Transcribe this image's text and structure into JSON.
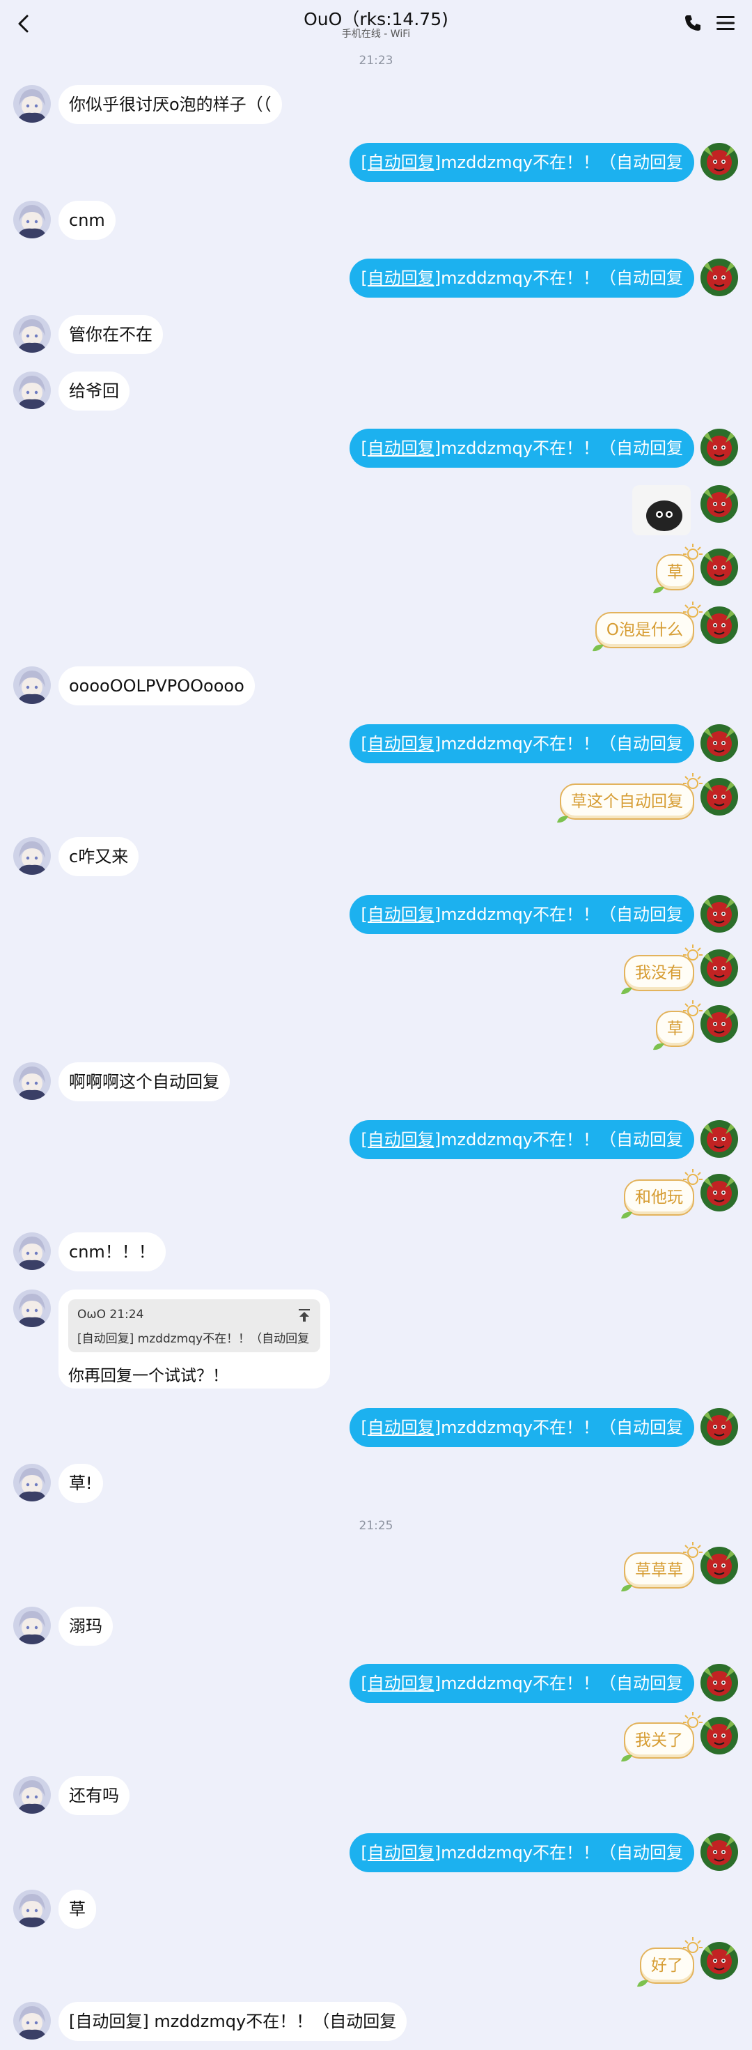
{
  "header": {
    "title": "OuO（rks:14.75)",
    "subtitle": "手机在线 - WiFi"
  },
  "timestamps": [
    "21:23",
    "21:25"
  ],
  "auto_reply": {
    "tag": "[自动回复]",
    "body": "mzddzmqy不在！！（自动回复"
  },
  "messages": {
    "m1": "你似乎很讨厌o泡的样子（（",
    "m2": "cnm",
    "m3": "管你在不在",
    "m4": "给爷回",
    "m5": "草",
    "m6": "O泡是什么",
    "m7": "ooooOOLPVPOOoooo",
    "m8": "草这个自动回复",
    "m9": "c咋又来",
    "m10": "我没有",
    "m11": "草",
    "m12": "啊啊啊这个自动回复",
    "m13": "和他玩",
    "m14": "cnm！！！",
    "m16": "草!",
    "m17": "草草草",
    "m18": "溺玛",
    "m19": "我关了",
    "m20": "还有吗",
    "m21": "草",
    "m22": "好了",
    "m23": "[自动回复] mzddzmqy不在！！（自动回复"
  },
  "quote": {
    "meta": "OωO 21:24",
    "text": "[自动回复] mzddzmqy不在！！（自动回复",
    "reply": "你再回复一个试试？！"
  },
  "colors": {
    "background": "#eef0fa",
    "auto_bubble": "#1cb1ef",
    "sun_text": "#d69c32"
  }
}
